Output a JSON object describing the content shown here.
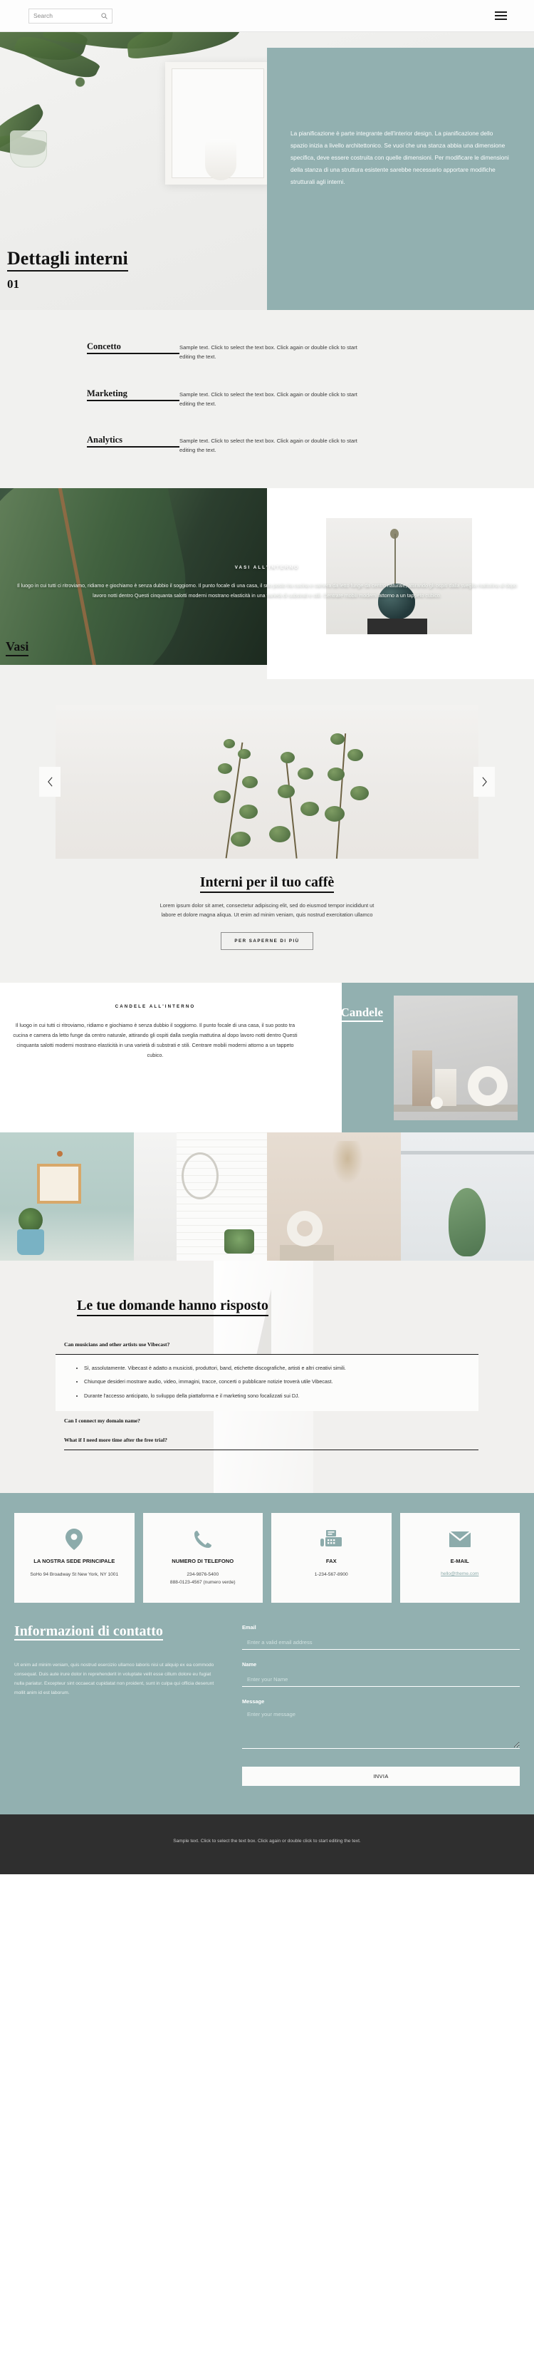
{
  "topbar": {
    "search_placeholder": "Search",
    "search_value": "",
    "search_icon": "search-icon",
    "menu_icon": "hamburger-menu-icon"
  },
  "hero": {
    "title": "Dettagli interni",
    "subtitle": "01",
    "panel_text": "La pianificazione è parte integrante dell'interior design. La pianificazione dello spazio inizia a livello architettonico. Se vuoi che una stanza abbia una dimensione specifica, deve essere costruita con quelle dimensioni. Per modificare le dimensioni della stanza di una struttura esistente sarebbe necessario apportare modifiche strutturali agli interni.",
    "panel_color": "#92b0b0"
  },
  "features": [
    {
      "title": "Concetto",
      "desc": "Sample text. Click to select the text box. Click again or double click to start editing the text."
    },
    {
      "title": "Marketing",
      "desc": "Sample text. Click to select the text box. Click again or double click to start editing the text."
    },
    {
      "title": "Analytics",
      "desc": "Sample text. Click to select the text box. Click again or double click to start editing the text."
    }
  ],
  "vasi": {
    "kicker": "VASI ALL'INTERNO",
    "body": "Il luogo in cui tutti ci ritroviamo, ridiamo e giochiamo è senza dubbio il soggiorno. Il punto focale di una casa, il suo posto tra cucina e camera da letto funge da centro naturale, attirando gli ospiti dalla sveglia mattutina al dopo lavoro notti dentro Questi cinquanta salotti moderni mostrano elasticità in una varietà di substrati e stili. Centrare mobili moderni attorno a un tappeto cubico.",
    "label": "Vasi"
  },
  "slider": {
    "prev_icon": "chevron-left-icon",
    "next_icon": "chevron-right-icon",
    "title": "Interni per il tuo caffè",
    "text": "Lorem ipsum dolor sit amet, consectetur adipiscing elit, sed do eiusmod tempor incididunt ut labore et dolore magna aliqua. Ut enim ad minim veniam, quis nostrud exercitation ullamco",
    "button": "PER SAPERNE DI PIÙ"
  },
  "candele": {
    "kicker": "CANDELE ALL'INTERNO",
    "body": "Il luogo in cui tutti ci ritroviamo, ridiamo e giochiamo è senza dubbio il soggiorno. Il punto focale di una casa, il suo posto tra cucina e camera da letto funge da centro naturale, attirando gli ospiti dalla sveglia mattutina al dopo lavoro notti dentro Questi cinquanta salotti moderni mostrano elasticità in una varietà di substrati e stili. Centrare mobili moderni attorno a un tappeto cubico.",
    "label": "Candele"
  },
  "faq": {
    "title": "Le tue domande hanno risposto",
    "items": [
      {
        "question": "Can musicians and other artists use Vibecast?",
        "open": true,
        "answers": [
          "Sì, assolutamente. Vibecast è adatto a musicisti, produttori, band, etichette discografiche, artisti e altri creativi simili.",
          "Chiunque desideri mostrare audio, video, immagini, tracce, concerti o pubblicare notizie troverà utile Vibecast.",
          "Durante l'accesso anticipato, lo sviluppo della piattaforma e il marketing sono focalizzati sui DJ."
        ]
      },
      {
        "question": "Can I connect my domain name?",
        "open": false,
        "answers": []
      },
      {
        "question": "What if I need more time after the free trial?",
        "open": false,
        "answers": []
      }
    ]
  },
  "contact_cards": [
    {
      "icon": "map-pin-icon",
      "title": "LA NOSTRA SEDE PRINCIPALE",
      "lines": [
        "SoHo 94 Broadway St New York, NY 1001"
      ],
      "link": ""
    },
    {
      "icon": "phone-icon",
      "title": "NUMERO DI TELEFONO",
      "lines": [
        "234-9876-5400",
        "888-0123-4567 (numero verde)"
      ],
      "link": ""
    },
    {
      "icon": "fax-icon",
      "title": "FAX",
      "lines": [
        "1-234-567-8900"
      ],
      "link": ""
    },
    {
      "icon": "envelope-icon",
      "title": "E-MAIL",
      "lines": [],
      "link": "hello@theme.com"
    }
  ],
  "contact_form": {
    "title": "Informazioni di contatto",
    "body": "Ut enim ad minim veniam, quis nostrud esercizio ullamco laboris nisi ut aliquip ex ea commodo consequat. Duis aute irure dolor in reprehenderit in voluptate velit esse cillum dolore eu fugiat nulla pariatur. Excepteur sint occaecat cupidatat non proident, sunt in culpa qui officia deserunt mollit anim id est laborum.",
    "email_label": "Email",
    "email_placeholder": "Enter a valid email address",
    "email_value": "",
    "name_label": "Name",
    "name_placeholder": "Enter your Name",
    "name_value": "",
    "message_label": "Message",
    "message_placeholder": "Enter your message",
    "message_value": "",
    "submit": "INVIA"
  },
  "footer": {
    "text": "Sample text. Click to select the text box. Click again or double click to start editing the text."
  }
}
